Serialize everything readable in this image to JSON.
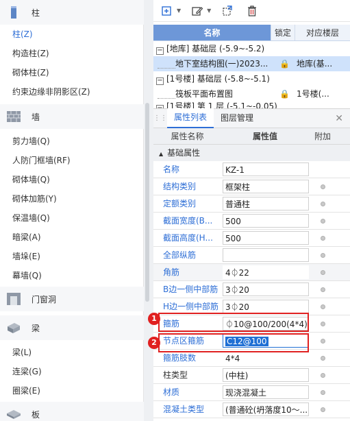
{
  "left": {
    "categories": [
      {
        "label": "柱",
        "icon": "column-icon"
      },
      {
        "label": "墙",
        "icon": "wall-icon"
      },
      {
        "label": "门窗洞",
        "icon": "door-window-icon"
      },
      {
        "label": "梁",
        "icon": "beam-icon"
      },
      {
        "label": "板",
        "icon": "slab-icon"
      }
    ],
    "column_items": [
      "柱(Z)",
      "构造柱(Z)",
      "砌体柱(Z)",
      "约束边缘非阴影区(Z)"
    ],
    "wall_items": [
      "剪力墙(Q)",
      "人防门框墙(RF)",
      "砌体墙(Q)",
      "砌体加筋(Y)",
      "保温墙(Q)",
      "暗梁(A)",
      "墙垛(E)",
      "幕墙(Q)"
    ],
    "beam_items": [
      "梁(L)",
      "连梁(G)",
      "圈梁(E)"
    ]
  },
  "layers": {
    "headers": [
      "名称",
      "锁定",
      "对应楼层"
    ],
    "groups": [
      {
        "label": "[地库] 基础层 (-5.9~-5.2)",
        "child": "地下室结构图(一)2023...",
        "floor": "库(基...",
        "floor_prefix": "地"
      },
      {
        "label": "[1号楼] 基础层 (-5.8~-5.1)",
        "child": "筏板平面布置图",
        "floor": "1号楼(..."
      }
    ],
    "partial": "[1号楼] 第 1 层 (-5.1~-0.05)"
  },
  "properties": {
    "tabs": [
      "属性列表",
      "图层管理"
    ],
    "headers": [
      "属性名称",
      "属性值",
      "附加"
    ],
    "group": "基础属性",
    "rows": [
      {
        "name": "名称",
        "value": "KZ-1"
      },
      {
        "name": "结构类别",
        "value": "框架柱"
      },
      {
        "name": "定额类别",
        "value": "普通柱"
      },
      {
        "name": "截面宽度(B...",
        "value": "500"
      },
      {
        "name": "截面高度(H...",
        "value": "500"
      },
      {
        "name": "全部纵筋",
        "value": ""
      },
      {
        "name": "角筋",
        "value": "4⏀22"
      },
      {
        "name": "B边一侧中部筋",
        "value": "3⏀20"
      },
      {
        "name": "H边一侧中部筋",
        "value": "3⏀20"
      },
      {
        "name": "箍筋",
        "value": "⏀10@100/200(4*4)"
      },
      {
        "name": "节点区箍筋",
        "value": "C12@100"
      },
      {
        "name": "箍筋肢数",
        "value": "4*4"
      },
      {
        "name": "柱类型",
        "value": "(中柱)"
      },
      {
        "name": "材质",
        "value": "现浇混凝土"
      },
      {
        "name": "混凝土类型",
        "value": "(普通砼(坍落度10～..."
      }
    ],
    "badges": [
      "1",
      "2"
    ]
  },
  "colors": {
    "accent": "#2d6ed6",
    "highlight": "#e02020",
    "selection": "#1f6fd4"
  }
}
